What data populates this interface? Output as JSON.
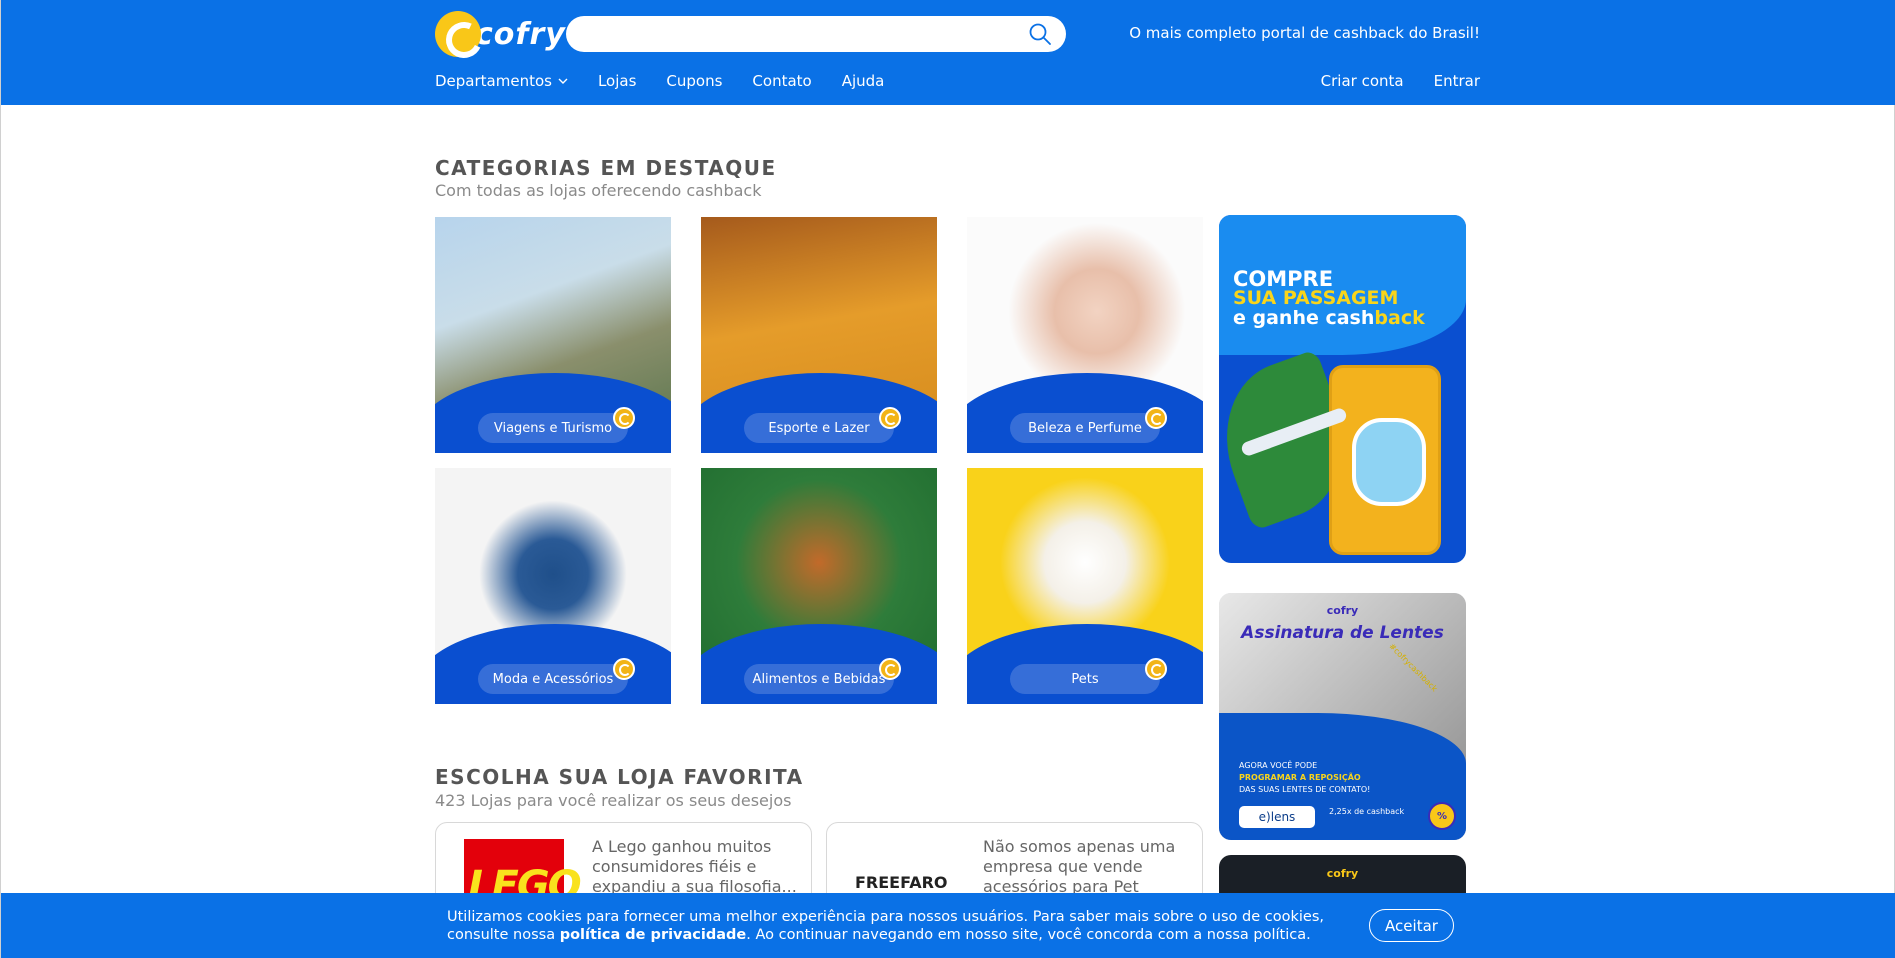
{
  "header": {
    "logo_text": "cofry",
    "search_placeholder": "",
    "tagline": "O mais completo portal de cashback do Brasil!",
    "nav": [
      "Departamentos",
      "Lojas",
      "Cupons",
      "Contato",
      "Ajuda"
    ],
    "account": [
      "Criar conta",
      "Entrar"
    ]
  },
  "categories": {
    "title": "CATEGORIAS EM DESTAQUE",
    "subtitle": "Com todas as lojas oferecendo cashback",
    "items": [
      {
        "label": "Viagens e Turismo"
      },
      {
        "label": "Esporte e Lazer"
      },
      {
        "label": "Beleza e Perfume"
      },
      {
        "label": "Moda e Acessórios"
      },
      {
        "label": "Alimentos e Bebidas"
      },
      {
        "label": "Pets"
      }
    ]
  },
  "banners": {
    "travel": {
      "line1": "COMPRE",
      "line2": "SUA PASSAGEM",
      "line3": "e ganhe cash",
      "line3_highlight": "back"
    },
    "lenses": {
      "brand": "cofry",
      "title": "Assinatura de Lentes",
      "hashtag": "#cofrycashback",
      "p1": "AGORA VOCÊ PODE",
      "p2": "PROGRAMAR A REPOSIÇÃO",
      "p3": "DAS SUAS LENTES DE CONTATO!",
      "lens_brand": "e)lens",
      "cashback": "2,25x de cashback",
      "badge": "%"
    },
    "third": {
      "brand": "cofry"
    }
  },
  "stores": {
    "title": "ESCOLHA SUA LOJA FAVORITA",
    "subtitle": "423 Lojas para você realizar os seus desejos",
    "items": [
      {
        "logo_text": "LEGO",
        "desc": "A Lego ganhou muitos consumidores fiéis e expandiu a sua filosofia..."
      },
      {
        "logo_text": "FREEFARO",
        "desc": "Não somos apenas uma empresa que vende acessórios para Pet Sho..."
      }
    ]
  },
  "cookie": {
    "text_before": "Utilizamos cookies para fornecer uma melhor experiência para nossos usuários. Para saber mais sobre o uso de cookies, consulte nossa ",
    "link": "política de privacidade",
    "text_after": ". Ao continuar navegando em nosso site, você concorda com a nossa política.",
    "accept": "Aceitar"
  },
  "colors": {
    "primary": "#0a71e6",
    "accent": "#f9c718",
    "wave": "#0a4fd0"
  }
}
